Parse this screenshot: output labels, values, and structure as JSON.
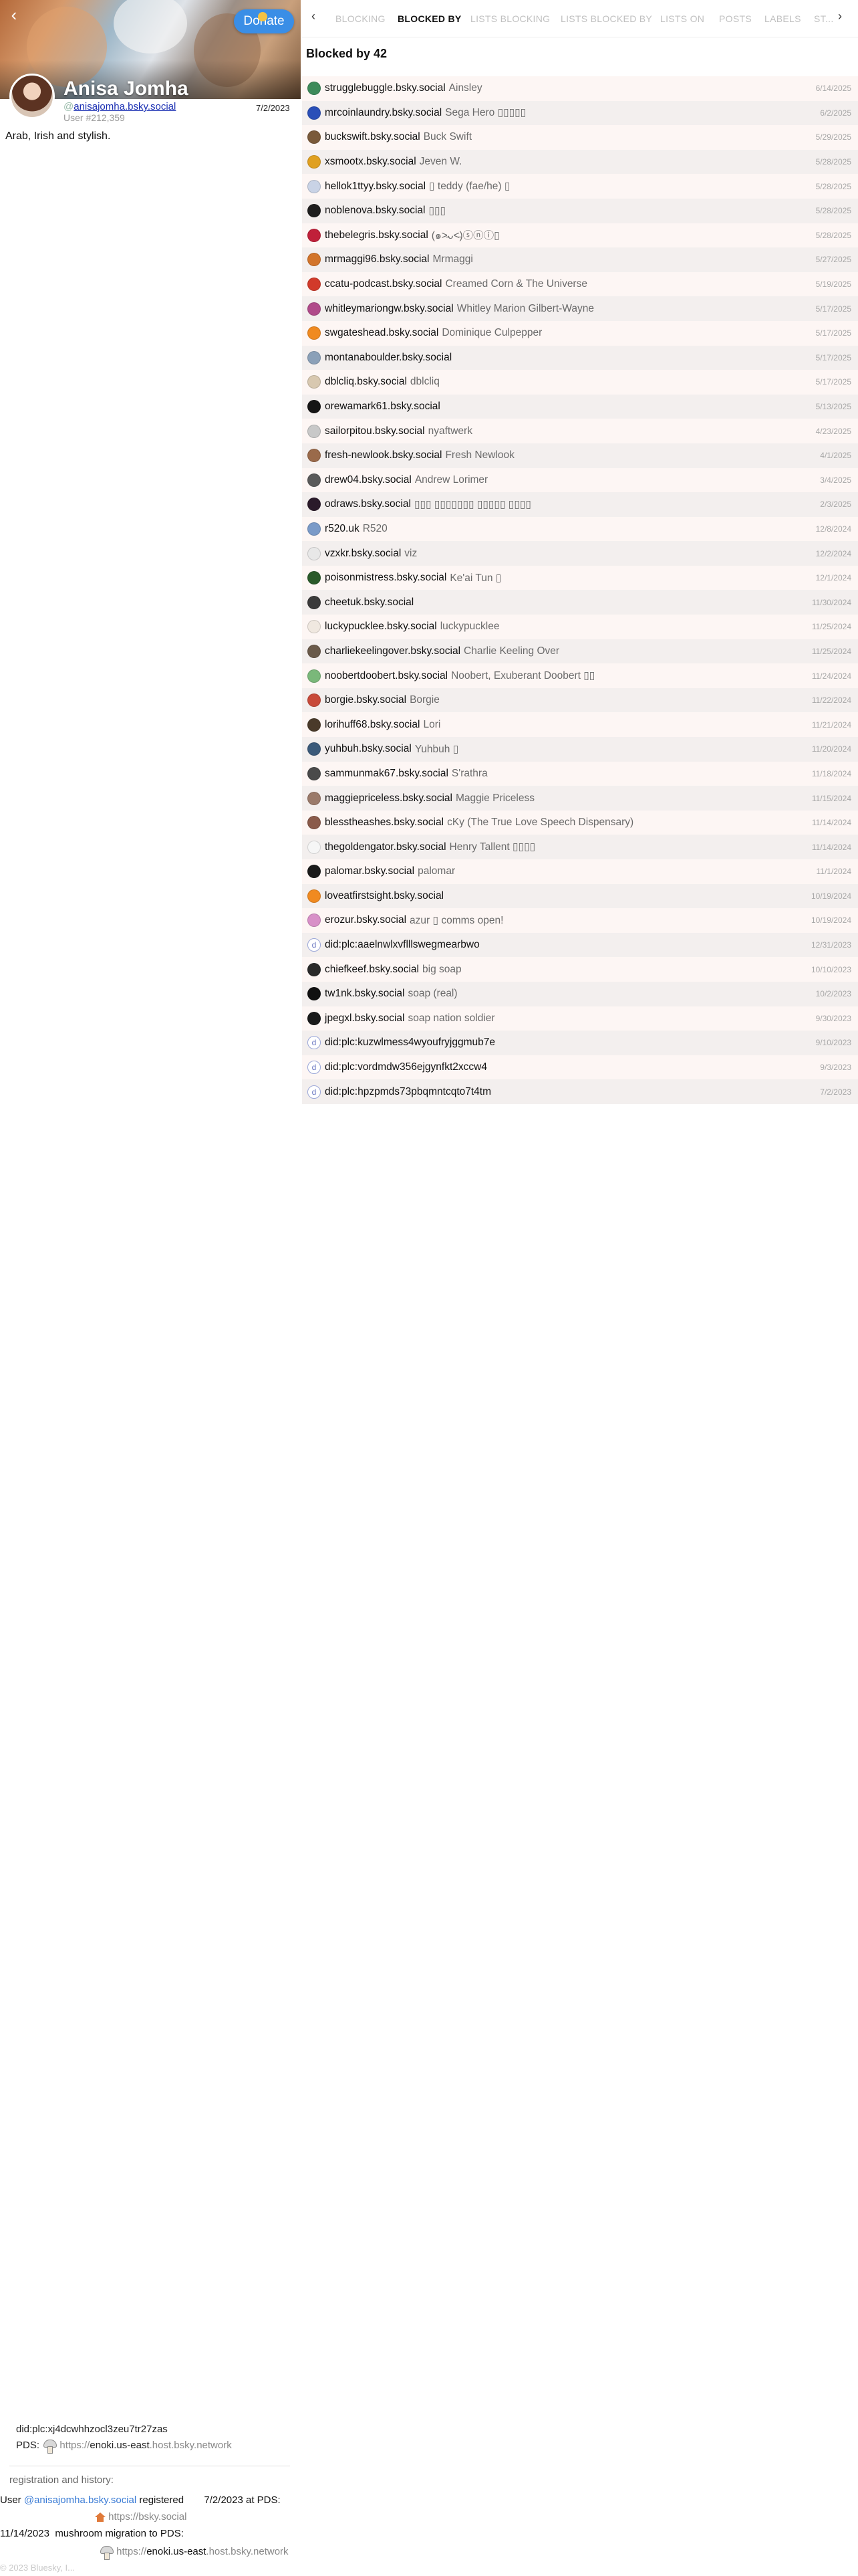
{
  "profile": {
    "back_icon": "chevron-left-icon",
    "donate_label": "Donate",
    "display_name": "Anisa Jomha",
    "handle_prefix": "@",
    "handle": "anisajomha.bsky.social",
    "user_number": "User #212,359",
    "registered_date": "7/2/2023",
    "bio": "Arab, Irish and stylish."
  },
  "identity": {
    "did": "did:plc:xj4dcwhhzocl3zeu7tr27zas",
    "pds_label": "PDS:",
    "pds_scheme": "https://",
    "pds_host": "enoki.us-east",
    "pds_suffix": ".host.bsky.network"
  },
  "history": {
    "title": "registration and history:",
    "user_word": "User",
    "handle": "@anisajomha.bsky.social",
    "registered_word": "registered",
    "date": "7/2/2023",
    "at_pds": "at PDS:",
    "first_pds": "https://bsky.social",
    "migration_date": "11/14/2023",
    "migration_text": "mushroom migration to PDS:",
    "new_pds_scheme": "https://",
    "new_pds_host": "enoki.us-east",
    "new_pds_suffix": ".host.bsky.network"
  },
  "footer": {
    "copyright": "© 2023 Bluesky, I..."
  },
  "tabs": {
    "prev_icon": "chevron-left-icon",
    "next_icon": "chevron-right-icon",
    "items": [
      "BLOCKING",
      "BLOCKED BY",
      "LISTS BLOCKING",
      "LISTS BLOCKED BY",
      "LISTS ON",
      "POSTS",
      "LABELS",
      "ST..."
    ],
    "active": "BLOCKED BY"
  },
  "blocked": {
    "heading": "Blocked by 42",
    "rows": [
      {
        "handle": "strugglebuggle.bsky.social",
        "name": "Ainsley",
        "date": "6/14/2025",
        "color": "#3d8a5a"
      },
      {
        "handle": "mrcoinlaundry.bsky.social",
        "name": "Sega Hero ▯▯▯▯▯",
        "date": "6/2/2025",
        "color": "#2a4fb8"
      },
      {
        "handle": "buckswift.bsky.social",
        "name": "Buck Swift",
        "date": "5/29/2025",
        "color": "#7a5a3a"
      },
      {
        "handle": "xsmootx.bsky.social",
        "name": "Jeven W.",
        "date": "5/28/2025",
        "color": "#e0a020"
      },
      {
        "handle": "hellok1ttyy.bsky.social",
        "name": "▯ teddy (fae/he) ▯",
        "date": "5/28/2025",
        "color": "#c9d3e6"
      },
      {
        "handle": "noblenova.bsky.social",
        "name": "▯▯▯",
        "date": "5/28/2025",
        "color": "#1e1e1e"
      },
      {
        "handle": "thebelegris.bsky.social",
        "name": "(๑˃̵ᴗ˂̵)ⓢⓝⓘ▯",
        "date": "5/28/2025",
        "color": "#c0203a"
      },
      {
        "handle": "mrmaggi96.bsky.social",
        "name": "Mrmaggi",
        "date": "5/27/2025",
        "color": "#d2742a"
      },
      {
        "handle": "ccatu-podcast.bsky.social",
        "name": "Creamed Corn & The Universe",
        "date": "5/19/2025",
        "color": "#d23a2a"
      },
      {
        "handle": "whitleymariongw.bsky.social",
        "name": "Whitley Marion Gilbert-Wayne",
        "date": "5/17/2025",
        "color": "#b04a8a"
      },
      {
        "handle": "swgateshead.bsky.social",
        "name": "Dominique Culpepper",
        "date": "5/17/2025",
        "color": "#f08a20"
      },
      {
        "handle": "montanaboulder.bsky.social",
        "name": "",
        "date": "5/17/2025",
        "color": "#8aa0b8"
      },
      {
        "handle": "dblcliq.bsky.social",
        "name": "dblcliq",
        "date": "5/17/2025",
        "color": "#d8c8b0"
      },
      {
        "handle": "orewamark61.bsky.social",
        "name": "",
        "date": "5/13/2025",
        "color": "#151515"
      },
      {
        "handle": "sailorpitou.bsky.social",
        "name": "nyaftwerk",
        "date": "4/23/2025",
        "color": "#c8c8c8"
      },
      {
        "handle": "fresh-newlook.bsky.social",
        "name": "Fresh Newlook",
        "date": "4/1/2025",
        "color": "#9a6a4a"
      },
      {
        "handle": "drew04.bsky.social",
        "name": "Andrew Lorimer",
        "date": "3/4/2025",
        "color": "#5a5a5a"
      },
      {
        "handle": "odraws.bsky.social",
        "name": "▯▯▯ ▯▯▯▯▯▯▯ ▯▯▯▯▯ ▯▯▯▯",
        "date": "2/3/2025",
        "color": "#2a1a2a"
      },
      {
        "handle": "r520.uk",
        "name": "R520",
        "date": "12/8/2024",
        "color": "#7a9ac8"
      },
      {
        "handle": "vzxkr.bsky.social",
        "name": "viz",
        "date": "12/2/2024",
        "color": "#e8e8e8"
      },
      {
        "handle": "poisonmistress.bsky.social",
        "name": "Ke'ai Tun ▯",
        "date": "12/1/2024",
        "color": "#2a5a2a"
      },
      {
        "handle": "cheetuk.bsky.social",
        "name": "",
        "date": "11/30/2024",
        "color": "#3a3a3a"
      },
      {
        "handle": "luckypucklee.bsky.social",
        "name": "luckypucklee",
        "date": "11/25/2024",
        "color": "#f0e8e0"
      },
      {
        "handle": "charliekeelingover.bsky.social",
        "name": "Charlie Keeling Over",
        "date": "11/25/2024",
        "color": "#6a5a4a"
      },
      {
        "handle": "noobertdoobert.bsky.social",
        "name": "Noobert, Exuberant Doobert ▯▯",
        "date": "11/24/2024",
        "color": "#7ab87a"
      },
      {
        "handle": "borgie.bsky.social",
        "name": "Borgie",
        "date": "11/22/2024",
        "color": "#c84a3a"
      },
      {
        "handle": "lorihuff68.bsky.social",
        "name": "Lori",
        "date": "11/21/2024",
        "color": "#4a3a2a"
      },
      {
        "handle": "yuhbuh.bsky.social",
        "name": "Yuhbuh ▯",
        "date": "11/20/2024",
        "color": "#3a5a7a"
      },
      {
        "handle": "sammunmak67.bsky.social",
        "name": "S'rathra",
        "date": "11/18/2024",
        "color": "#4a4a4a"
      },
      {
        "handle": "maggiepriceless.bsky.social",
        "name": "Maggie Priceless",
        "date": "11/15/2024",
        "color": "#9a7a6a"
      },
      {
        "handle": "blesstheashes.bsky.social",
        "name": "cKy (The True Love Speech Dispensary)",
        "date": "11/14/2024",
        "color": "#8a5a4a"
      },
      {
        "handle": "thegoldengator.bsky.social",
        "name": "Henry Tallent ▯▯▯▯",
        "date": "11/14/2024",
        "color": "#f6f6f6"
      },
      {
        "handle": "palomar.bsky.social",
        "name": "palomar",
        "date": "11/1/2024",
        "color": "#1a1a1a"
      },
      {
        "handle": "loveatfirstsight.bsky.social",
        "name": "",
        "date": "10/19/2024",
        "color": "#f08a20"
      },
      {
        "handle": "erozur.bsky.social",
        "name": "azur ▯ comms open!",
        "date": "10/19/2024",
        "color": "#d890c8"
      },
      {
        "handle": "did:plc:aaelnwlxvflllswegmearbwo",
        "name": "",
        "date": "12/31/2023",
        "color": "did"
      },
      {
        "handle": "chiefkeef.bsky.social",
        "name": "big soap",
        "date": "10/10/2023",
        "color": "#2a2a2a"
      },
      {
        "handle": "tw1nk.bsky.social",
        "name": "soap (real)",
        "date": "10/2/2023",
        "color": "#111111"
      },
      {
        "handle": "jpegxl.bsky.social",
        "name": "soap nation soldier",
        "date": "9/30/2023",
        "color": "#1a1a1a"
      },
      {
        "handle": "did:plc:kuzwlmess4wyoufryjggmub7e",
        "name": "",
        "date": "9/10/2023",
        "color": "did"
      },
      {
        "handle": "did:plc:vordmdw356ejgynfkt2xccw4",
        "name": "",
        "date": "9/3/2023",
        "color": "did"
      },
      {
        "handle": "did:plc:hpzpmds73pbqmntcqto7t4tm",
        "name": "",
        "date": "7/2/2023",
        "color": "did"
      }
    ]
  }
}
